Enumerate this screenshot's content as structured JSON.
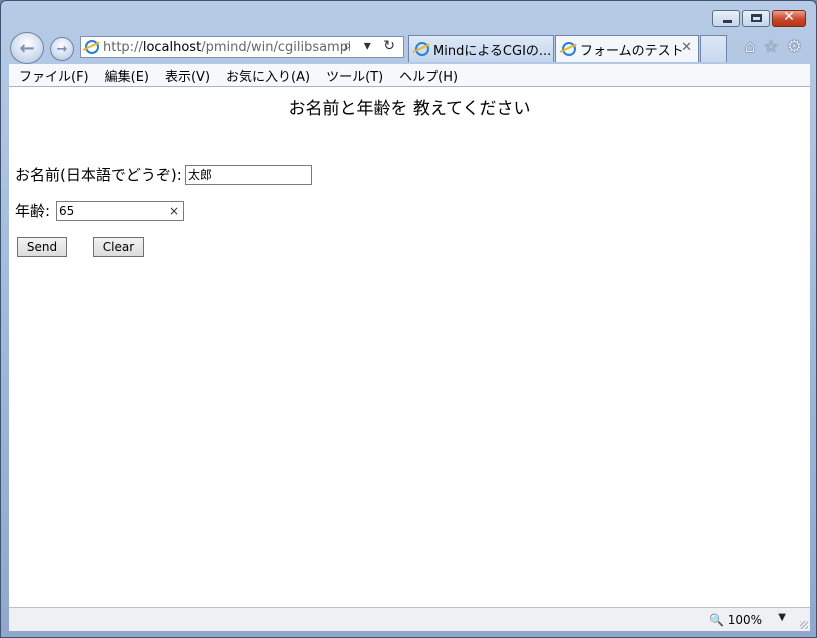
{
  "window": {
    "caption_buttons": {
      "minimize": "minimize",
      "maximize": "maximize",
      "close": "✕"
    }
  },
  "address_bar": {
    "url_prefix": "http://",
    "url_host": "localhost",
    "url_path": "/pmind/win/cgilibsample/t",
    "tools": "⌕ ▾ ↻"
  },
  "tabs": [
    {
      "label": "MindによるCGIの..."
    },
    {
      "label": "フォームのテスト",
      "close": "✕"
    }
  ],
  "toolbar_icons": {
    "home": "⌂",
    "favorites": "☆",
    "tools": "⚙"
  },
  "menu": [
    "ファイル(F)",
    "編集(E)",
    "表示(V)",
    "お気に入り(A)",
    "ツール(T)",
    "ヘルプ(H)"
  ],
  "page": {
    "heading": "お名前と年齢を 教えてください",
    "name_label": "お名前(日本語でどうぞ):",
    "name_value": "太郎",
    "age_label": "年齢:",
    "age_value": "65",
    "age_clear": "×",
    "send_label": "Send",
    "clear_label": "Clear"
  },
  "status": {
    "zoom": "🔍 100%",
    "zoom_dropdown": "▼"
  }
}
